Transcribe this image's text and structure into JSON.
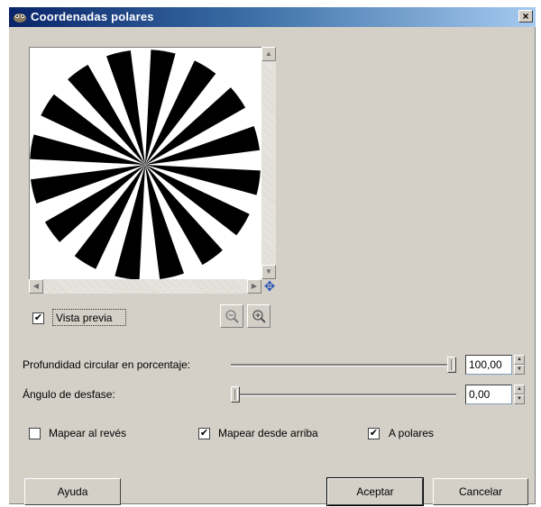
{
  "window": {
    "title": "Coordenadas polares",
    "close_label": "×"
  },
  "preview": {
    "checkbox_label": "Vista previa",
    "checkbox_checked": true,
    "zoom_out_icon": "zoom-out-icon",
    "zoom_in_icon": "zoom-in-icon",
    "navigate_icon": "move-icon"
  },
  "params": {
    "circle_depth": {
      "label": "Profundidad circular en porcentaje:",
      "value": "100,00",
      "fraction": 1.0
    },
    "offset_angle": {
      "label": "Ángulo de desfase:",
      "value": "0,00",
      "fraction": 0.0
    }
  },
  "options": {
    "map_backwards": {
      "label": "Mapear al revés",
      "checked": false
    },
    "map_from_top": {
      "label": "Mapear desde arriba",
      "checked": true
    },
    "to_polar": {
      "label": "A polares",
      "checked": true
    }
  },
  "buttons": {
    "help": "Ayuda",
    "ok": "Aceptar",
    "cancel": "Cancelar"
  },
  "colors": {
    "titlebar_start": "#0a246a",
    "titlebar_end": "#a6caf0",
    "dialog_bg": "#d4d0c8"
  }
}
